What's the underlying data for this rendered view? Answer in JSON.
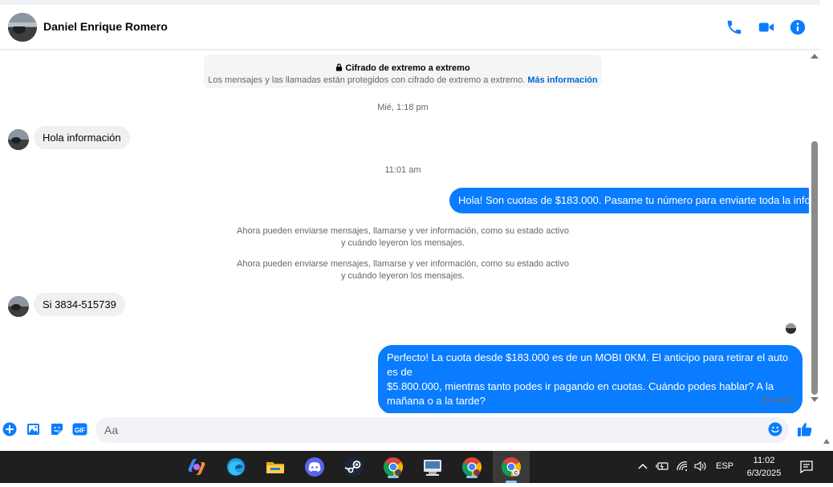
{
  "header": {
    "contact_name": "Daniel Enrique Romero",
    "icons": [
      "phone-icon",
      "video-camera-icon",
      "info-icon"
    ],
    "accent_color": "#0a7cff"
  },
  "encryption": {
    "title": "Cifrado de extremo a extremo",
    "text": "Los mensajes y las llamadas están protegidos con cifrado de extremo a extremo.",
    "link": "Más información"
  },
  "conversation": {
    "timestamp_1": "Mié, 1:18 pm",
    "incoming_1": "Hola información",
    "timestamp_2": "11:01 am",
    "outgoing_1": "Hola! Son cuotas de $183.000. Pasame tu número para enviarte toda la info",
    "system_1_line1": "Ahora pueden enviarse mensajes, llamarse y ver información, como su estado activo",
    "system_1_line2": "y cuándo leyeron los mensajes.",
    "system_2_line1": "Ahora pueden enviarse mensajes, llamarse y ver información, como su estado activo",
    "system_2_line2": "y cuándo leyeron los mensajes.",
    "incoming_2": "Si 3834-515739",
    "outgoing_2_line1": "Perfecto! La cuota desde $183.000 es de un MOBI 0KM. El anticipo para retirar el auto es de",
    "outgoing_2_line2": "$5.800.000, mientras tanto podes ir pagando en cuotas. Cuándo podes hablar? A la",
    "outgoing_2_line3": "mañana o a la tarde?",
    "status": "Enviado"
  },
  "composer": {
    "placeholder": "Aa",
    "icons": [
      "plus-icon",
      "gallery-icon",
      "sticker-icon",
      "gif-icon",
      "emoji-icon",
      "thumbs-up-icon"
    ],
    "gif_label": "GIF"
  },
  "taskbar": {
    "apps": [
      "copilot-icon",
      "edge-icon",
      "file-explorer-icon",
      "discord-icon",
      "steam-icon",
      "chrome-icon",
      "remote-desktop-icon",
      "chrome-profile-icon",
      "chrome-profile-c-icon"
    ],
    "language": "ESP",
    "time": "11:02",
    "date": "6/3/2025"
  }
}
